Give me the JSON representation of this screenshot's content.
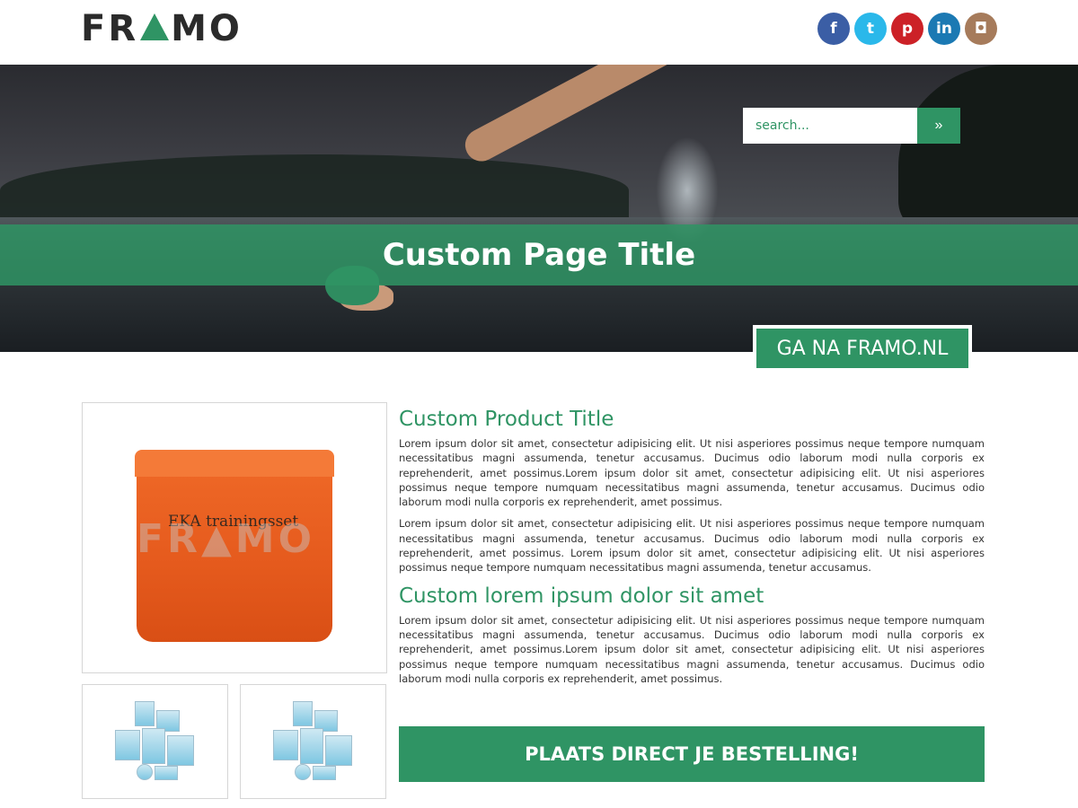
{
  "header": {
    "logo_left": "FR",
    "logo_right": "MO",
    "social": [
      {
        "name": "facebook",
        "glyph": "f"
      },
      {
        "name": "twitter",
        "glyph": "t"
      },
      {
        "name": "pinterest",
        "glyph": "p"
      },
      {
        "name": "linkedin",
        "glyph": "in"
      },
      {
        "name": "instagram",
        "glyph": "◘"
      }
    ]
  },
  "hero": {
    "title": "Custom Page Title",
    "search_placeholder": "search...",
    "search_button": "»",
    "cta_label": "GA NA FRAMO.NL"
  },
  "product": {
    "image_label": "EKA trainingsset",
    "watermark_left": "FR",
    "watermark_right": "MO",
    "title": "Custom Product Title",
    "paragraph_1": "Lorem ipsum dolor sit amet, consectetur adipisicing elit. Ut nisi asperiores possimus neque tempore numquam necessitatibus magni assumenda, tenetur accusamus. Ducimus odio laborum modi nulla corporis ex reprehenderit, amet possimus.Lorem ipsum dolor sit amet, consectetur adipisicing elit. Ut nisi asperiores possimus neque tempore numquam necessitatibus magni assumenda, tenetur accusamus. Ducimus odio laborum modi nulla corporis ex reprehenderit, amet possimus.",
    "paragraph_2": "Lorem ipsum dolor sit amet, consectetur adipisicing elit. Ut nisi asperiores possimus neque tempore numquam necessitatibus magni assumenda, tenetur accusamus. Ducimus odio laborum modi nulla corporis ex reprehenderit, amet possimus. Lorem ipsum dolor sit amet, consectetur adipisicing elit. Ut nisi asperiores possimus neque tempore numquam necessitatibus magni assumenda, tenetur accusamus.",
    "subtitle": "Custom lorem ipsum dolor sit amet",
    "paragraph_3": "Lorem ipsum dolor sit amet, consectetur adipisicing elit. Ut nisi asperiores possimus neque tempore numquam necessitatibus magni assumenda, tenetur accusamus. Ducimus odio laborum modi nulla corporis ex reprehenderit, amet possimus.Lorem ipsum dolor sit amet, consectetur adipisicing elit. Ut nisi asperiores possimus neque tempore numquam necessitatibus magni assumenda, tenetur accusamus. Ducimus odio laborum modi nulla corporis ex reprehenderit, amet possimus.",
    "order_button": "PLAATS DIRECT JE BESTELLING!"
  },
  "colors": {
    "brand_green": "#2f9464",
    "facebook": "#3b5ea5",
    "twitter": "#2ab8ea",
    "pinterest": "#cc2127",
    "linkedin": "#1b79b3",
    "instagram": "#a67b5b"
  }
}
